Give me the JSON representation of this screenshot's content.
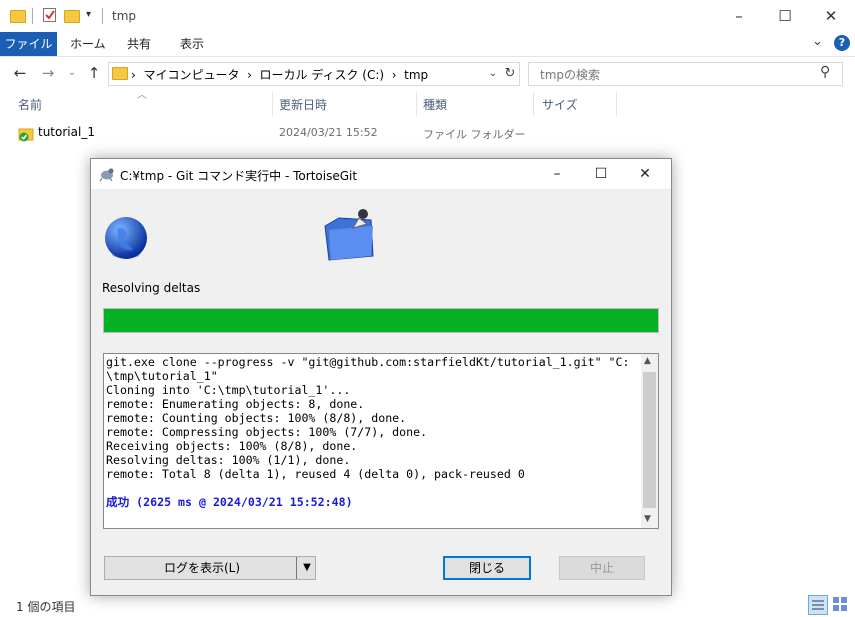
{
  "window": {
    "title": "tmp"
  },
  "ribbon": {
    "tabs": [
      "ファイル",
      "ホーム",
      "共有",
      "表示"
    ]
  },
  "address": {
    "path": [
      "マイコンピュータ",
      "ローカル ディスク (C:)",
      "tmp"
    ]
  },
  "search": {
    "placeholder": "tmpの検索"
  },
  "columns": {
    "name": "名前",
    "date": "更新日時",
    "type": "種類",
    "size": "サイズ"
  },
  "files": [
    {
      "name": "tutorial_1",
      "date": "2024/03/21 15:52",
      "type": "ファイル フォルダー"
    }
  ],
  "status": {
    "count": "1 個の項目"
  },
  "dialog": {
    "title": "C:¥tmp - Git コマンド実行中 - TortoiseGit",
    "status_text": "Resolving deltas",
    "progress": 1.0,
    "progress_color": "#06b025",
    "log_lines": [
      "git.exe clone --progress -v \"git@github.com:starfieldKt/tutorial_1.git\" \"C:",
      "\\tmp\\tutorial_1\"",
      "Cloning into 'C:\\tmp\\tutorial_1'...",
      "remote: Enumerating objects: 8, done.",
      "remote: Counting objects: 100% (8/8), done.",
      "remote: Compressing objects: 100% (7/7), done.",
      "Receiving objects: 100% (8/8), done.",
      "Resolving deltas: 100% (1/1), done.",
      "remote: Total 8 (delta 1), reused 4 (delta 0), pack-reused 0"
    ],
    "log_success": "成功 (2625 ms @ 2024/03/21 15:52:48)",
    "buttons": {
      "show_log": "ログを表示(L)",
      "close": "閉じる",
      "abort": "中止"
    }
  }
}
